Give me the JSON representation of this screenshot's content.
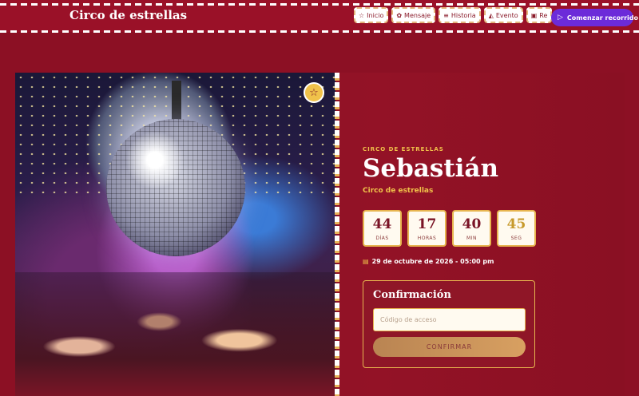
{
  "header": {
    "brand": "Circo de estrellas",
    "nav": [
      {
        "label": "Inicio",
        "icon": "star-icon",
        "glyph": "☆"
      },
      {
        "label": "Mensaje",
        "icon": "paw-icon",
        "glyph": "✿"
      },
      {
        "label": "Historia",
        "icon": "list-icon",
        "glyph": "≡"
      },
      {
        "label": "Evento",
        "icon": "chart-icon",
        "glyph": "◭"
      },
      {
        "label": "Re",
        "icon": "gift-icon",
        "glyph": "▣"
      }
    ],
    "cta_label": "Comenzar recorrido"
  },
  "hero": {
    "eyebrow": "CIRCO DE ESTRELLAS",
    "name": "Sebastián",
    "subtitle": "Circo de estrellas",
    "countdown": [
      {
        "value": "44",
        "label": "DÍAS"
      },
      {
        "value": "17",
        "label": "HORAS"
      },
      {
        "value": "40",
        "label": "MIN"
      },
      {
        "value": "45",
        "label": "SEG"
      }
    ],
    "date": "29 de octubre de 2026 - 05:00 pm"
  },
  "confirmation": {
    "title": "Confirmación",
    "placeholder": "Código de acceso",
    "button": "CONFIRMAR"
  },
  "colors": {
    "background": "#8c1024",
    "accent_gold": "#f0c24a",
    "cta_purple": "#6c2bd9"
  }
}
